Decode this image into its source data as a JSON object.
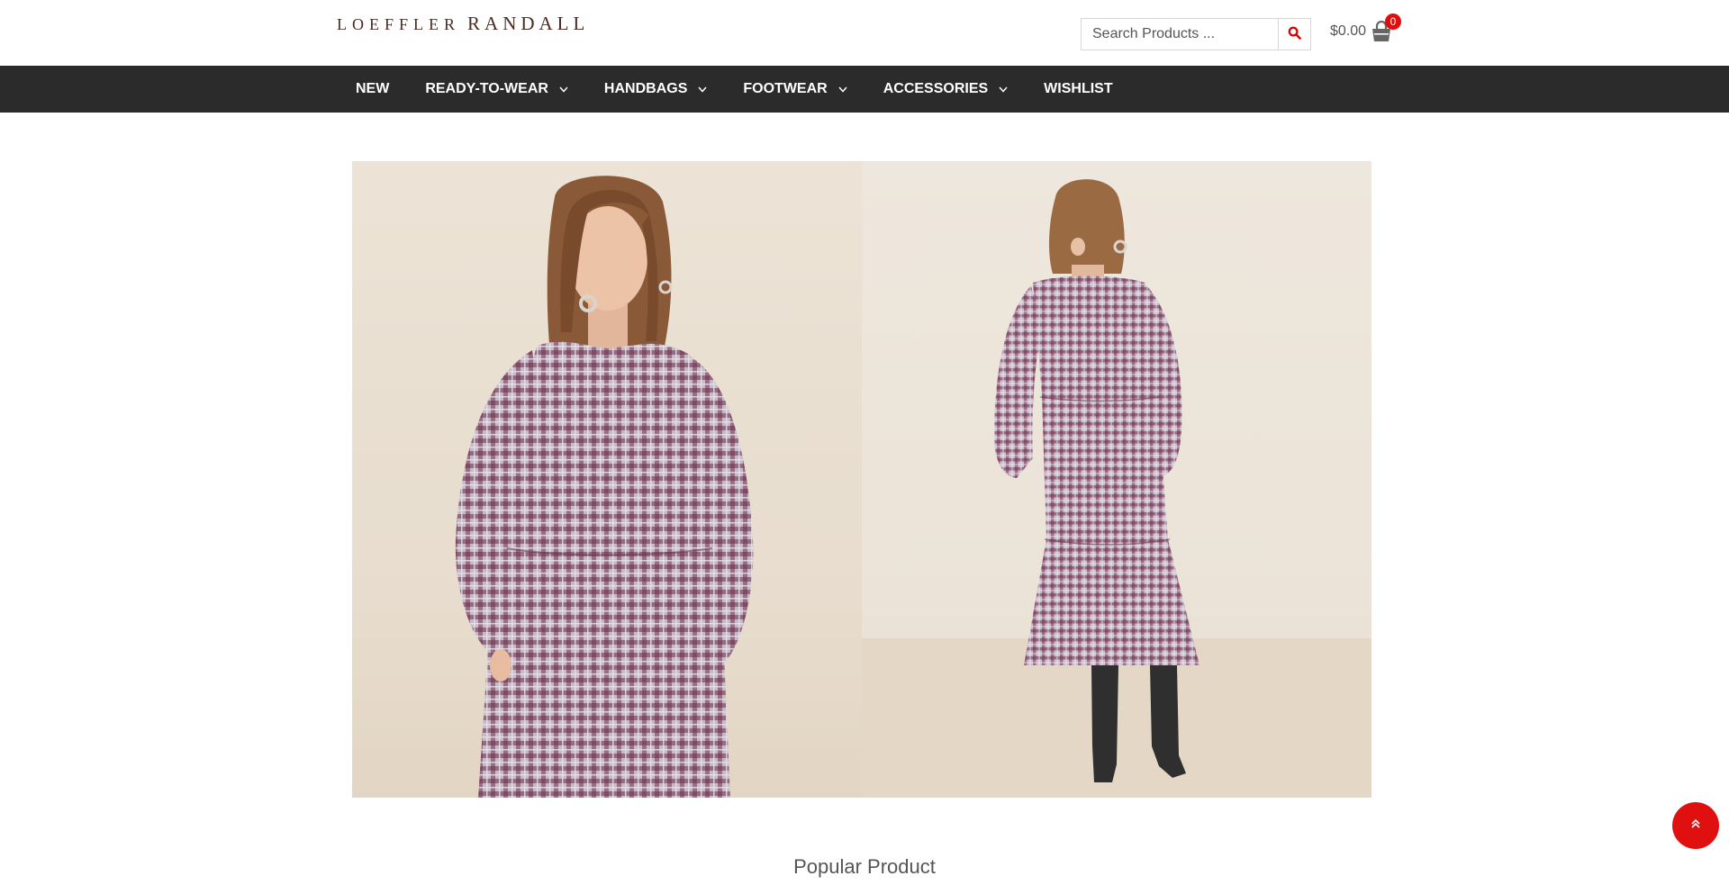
{
  "brand": {
    "logo_part1": "LOEFFLER",
    "logo_part2": "RANDALL"
  },
  "search": {
    "placeholder": "Search Products ...",
    "value": ""
  },
  "cart": {
    "total": "$0.00",
    "count": "0"
  },
  "nav": {
    "items": [
      {
        "label": "NEW",
        "has_dropdown": false
      },
      {
        "label": "READY-TO-WEAR",
        "has_dropdown": true
      },
      {
        "label": "HANDBAGS",
        "has_dropdown": true
      },
      {
        "label": "FOOTWEAR",
        "has_dropdown": true
      },
      {
        "label": "ACCESSORIES",
        "has_dropdown": true
      },
      {
        "label": "WISHLIST",
        "has_dropdown": false
      }
    ]
  },
  "hero": {
    "images": [
      "model-front-view",
      "model-back-view"
    ]
  },
  "sections": {
    "popular_title": "Popular Product"
  },
  "colors": {
    "nav_bg": "#2b2b2b",
    "accent": "#e00d0d",
    "logo": "#4a2a22"
  },
  "icons": {
    "search": "search-icon",
    "cart": "shopping-bag-icon",
    "to_top": "double-chevron-up-icon",
    "dropdown": "chevron-down-icon"
  }
}
